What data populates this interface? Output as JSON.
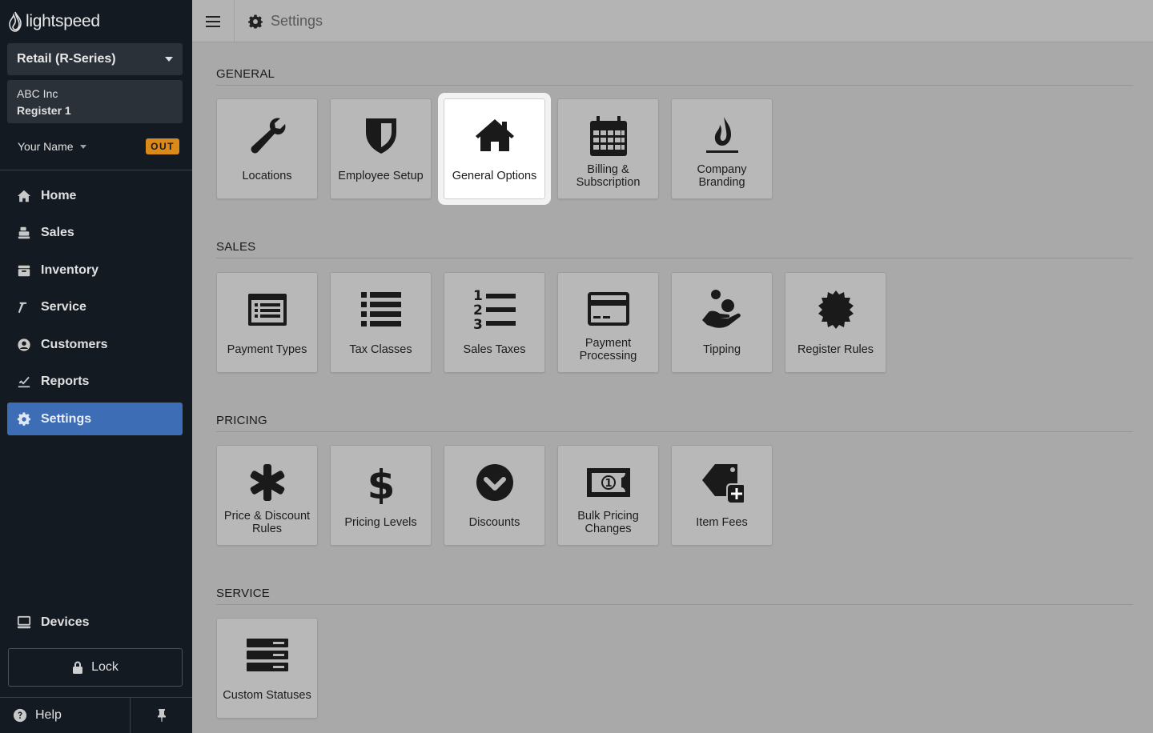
{
  "brand": {
    "name": "lightspeed"
  },
  "sidebar": {
    "store_selector": "Retail (R-Series)",
    "company": "ABC Inc",
    "register": "Register 1",
    "user_name": "Your Name",
    "clock_status": "OUT",
    "nav": [
      {
        "label": "Home",
        "icon": "home-icon"
      },
      {
        "label": "Sales",
        "icon": "register-icon"
      },
      {
        "label": "Inventory",
        "icon": "inventory-icon"
      },
      {
        "label": "Service",
        "icon": "hammer-icon"
      },
      {
        "label": "Customers",
        "icon": "user-icon"
      },
      {
        "label": "Reports",
        "icon": "chart-icon"
      },
      {
        "label": "Settings",
        "icon": "gear-icon",
        "active": true
      }
    ],
    "devices_label": "Devices",
    "lock_label": "Lock",
    "help_label": "Help"
  },
  "topbar": {
    "title": "Settings"
  },
  "sections": {
    "general": {
      "title": "GENERAL",
      "tiles": [
        {
          "label": "Locations",
          "icon": "wrench-icon"
        },
        {
          "label": "Employee Setup",
          "icon": "shield-icon"
        },
        {
          "label": "General Options",
          "icon": "home-icon",
          "highlighted": true
        },
        {
          "label": "Billing & Subscription",
          "icon": "calendar-icon"
        },
        {
          "label": "Company Branding",
          "icon": "flame-icon"
        }
      ]
    },
    "sales": {
      "title": "SALES",
      "tiles": [
        {
          "label": "Payment Types",
          "icon": "list-card-icon"
        },
        {
          "label": "Tax Classes",
          "icon": "list-icon"
        },
        {
          "label": "Sales Taxes",
          "icon": "numbered-list-icon"
        },
        {
          "label": "Payment Processing",
          "icon": "credit-card-icon"
        },
        {
          "label": "Tipping",
          "icon": "hand-coin-icon"
        },
        {
          "label": "Register Rules",
          "icon": "certificate-icon"
        }
      ]
    },
    "pricing": {
      "title": "PRICING",
      "tiles": [
        {
          "label": "Price & Discount Rules",
          "icon": "asterisk-icon"
        },
        {
          "label": "Pricing Levels",
          "icon": "dollar-icon"
        },
        {
          "label": "Discounts",
          "icon": "check-circle-icon"
        },
        {
          "label": "Bulk Pricing Changes",
          "icon": "money-bill-icon"
        },
        {
          "label": "Item Fees",
          "icon": "tag-plus-icon"
        }
      ]
    },
    "service": {
      "title": "SERVICE",
      "tiles": [
        {
          "label": "Custom Statuses",
          "icon": "server-icon"
        }
      ]
    }
  },
  "colors": {
    "sidebar_bg": "#141a22",
    "active_nav": "#3d6db5",
    "out_badge": "#d98a1b",
    "content_bg": "#a9a9a9"
  }
}
